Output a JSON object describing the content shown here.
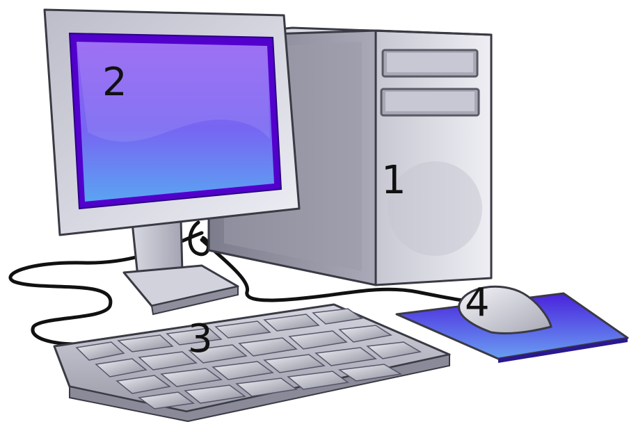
{
  "labels": {
    "tower": "1",
    "monitor": "2",
    "keyboard": "3",
    "mouse": "4"
  },
  "colors": {
    "case_light": "#e2e2ea",
    "case_mid": "#c3c3cf",
    "case_dark": "#8e8e9c",
    "outline": "#3a3a44",
    "screen_top": "#8a58f0",
    "screen_bottom": "#5a9af0",
    "screen_frame": "#5200cc",
    "pad_color": "#4b2ee0",
    "cable": "#111111"
  }
}
